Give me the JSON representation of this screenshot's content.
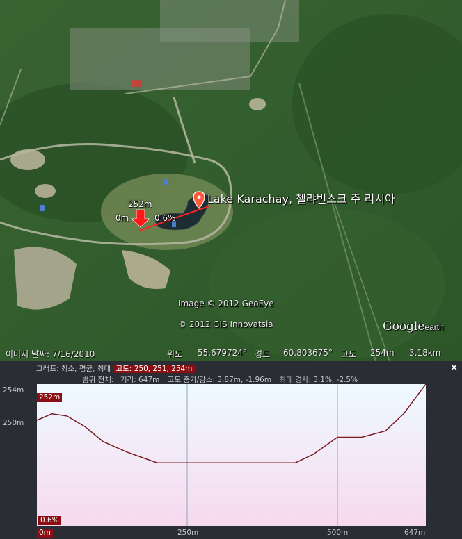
{
  "map": {
    "placemark_label": "Lake Karachay, 첼랴빈스크 주 리시아",
    "credits": [
      "Image © 2012 GeoEye",
      "© 2012 GIS Innovatsia"
    ],
    "logo_main": "Google",
    "logo_sub": "earth",
    "markers": {
      "elevation": "252m",
      "start": "0m",
      "slope": "0.6%"
    }
  },
  "statusbar": {
    "image_date": "이미지 날짜: 7/16/2010",
    "lat_label": "위도",
    "lat": "55.679724°",
    "lon_label": "경도",
    "lon": "60.803675°",
    "elev_label": "고도",
    "elev": "254m",
    "eye_alt": "3.18km"
  },
  "profile": {
    "close_label": "×",
    "row1_prefix": "그래프: 최소, 평균, 최대",
    "row1_highlight": "고도: 250, 251, 254m",
    "row2_prefix": "범위 전체:",
    "row2_distance": "거리: 647m",
    "row2_gain": "고도 증가/감소: 3.87m, -1.96m",
    "row2_slope": "최대 경사: 3.1%, -2.5%",
    "y_top": "254m",
    "y_mid": "250m",
    "cursor_elev": "252m",
    "cursor_slope": "0.6%",
    "cursor_dist": "0m",
    "x_ticks": [
      "250m",
      "500m",
      "647m"
    ]
  },
  "chart_data": {
    "type": "line",
    "x": [
      0,
      25,
      50,
      80,
      110,
      150,
      200,
      250,
      300,
      350,
      400,
      430,
      460,
      500,
      540,
      580,
      610,
      647
    ],
    "y": [
      252.3,
      252.6,
      252.5,
      252.0,
      251.3,
      250.8,
      250.3,
      250.3,
      250.3,
      250.3,
      250.3,
      250.3,
      250.7,
      251.5,
      251.5,
      251.8,
      252.6,
      254.0
    ],
    "xlabel": "",
    "ylabel": "",
    "xlim": [
      0,
      647
    ],
    "ylim": [
      247.3,
      254.0
    ],
    "colors": {
      "line": "#7a1a22",
      "gridline": "#8fa8b8",
      "accent": "#8b0e12"
    }
  }
}
